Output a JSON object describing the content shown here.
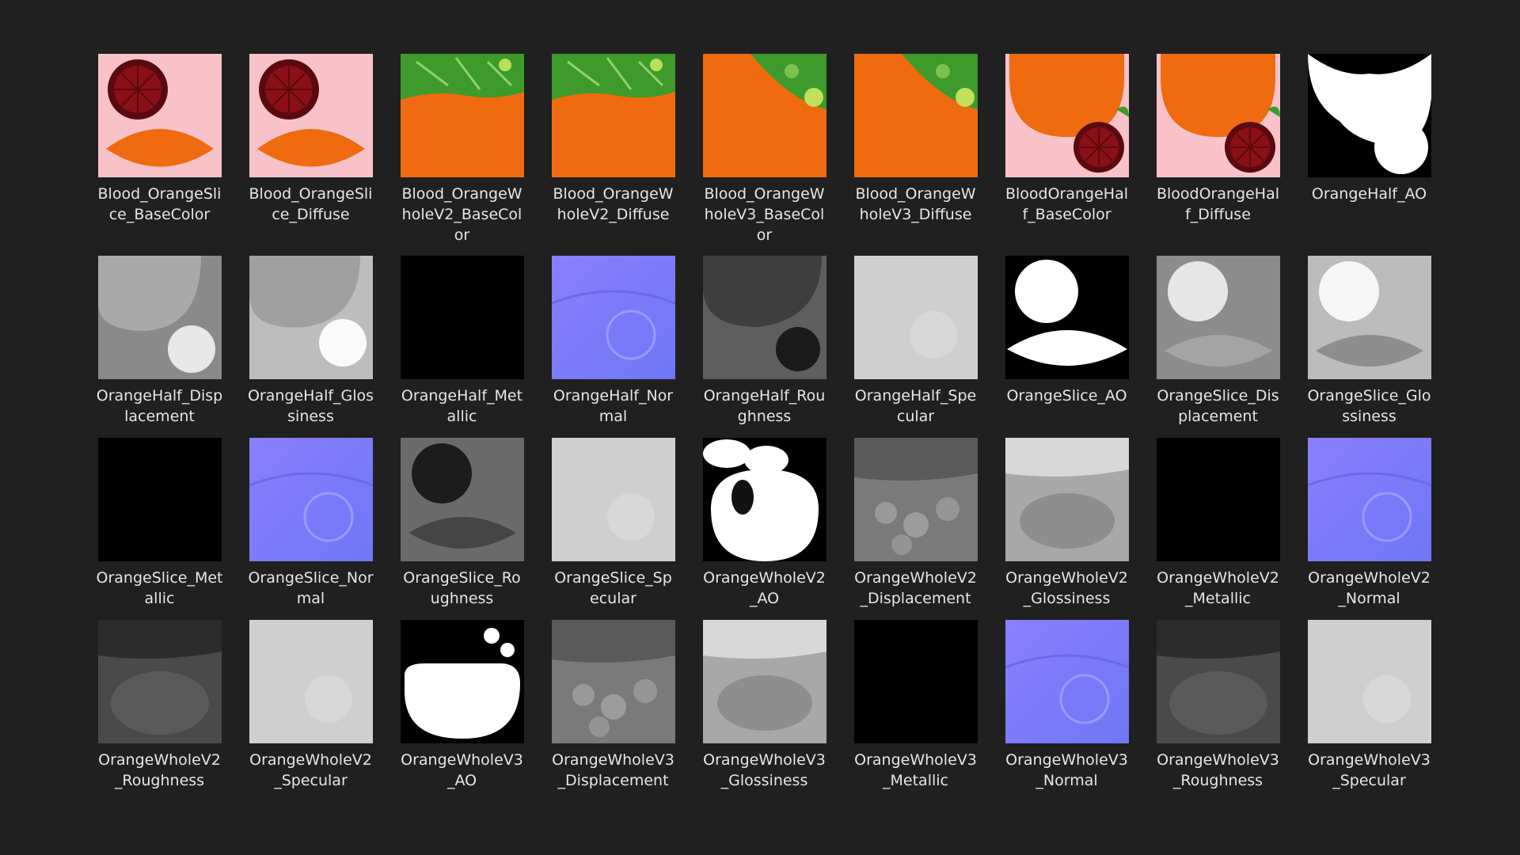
{
  "view": "file-explorer-large-icons",
  "files": [
    {
      "name": "Blood_OrangeSlice_BaseColor",
      "thumb": "slice-color"
    },
    {
      "name": "Blood_OrangeSlice_Diffuse",
      "thumb": "slice-color"
    },
    {
      "name": "Blood_OrangeWholeV2_BaseColor",
      "thumb": "whole-v2-color"
    },
    {
      "name": "Blood_OrangeWholeV2_Diffuse",
      "thumb": "whole-v2-color"
    },
    {
      "name": "Blood_OrangeWholeV3_BaseColor",
      "thumb": "whole-v3-color"
    },
    {
      "name": "Blood_OrangeWholeV3_Diffuse",
      "thumb": "whole-v3-color"
    },
    {
      "name": "BloodOrangeHalf_BaseColor",
      "thumb": "half-color"
    },
    {
      "name": "BloodOrangeHalf_Diffuse",
      "thumb": "half-color"
    },
    {
      "name": "OrangeHalf_AO",
      "thumb": "half-ao"
    },
    {
      "name": "OrangeHalf_Displacement",
      "thumb": "half-disp"
    },
    {
      "name": "OrangeHalf_Glossiness",
      "thumb": "half-gloss"
    },
    {
      "name": "OrangeHalf_Metallic",
      "thumb": "black"
    },
    {
      "name": "OrangeHalf_Normal",
      "thumb": "normal"
    },
    {
      "name": "OrangeHalf_Roughness",
      "thumb": "half-rough"
    },
    {
      "name": "OrangeHalf_Specular",
      "thumb": "light-gray"
    },
    {
      "name": "OrangeSlice_AO",
      "thumb": "slice-ao"
    },
    {
      "name": "OrangeSlice_Displacement",
      "thumb": "slice-disp"
    },
    {
      "name": "OrangeSlice_Glossiness",
      "thumb": "slice-gloss"
    },
    {
      "name": "OrangeSlice_Metallic",
      "thumb": "black"
    },
    {
      "name": "OrangeSlice_Normal",
      "thumb": "normal"
    },
    {
      "name": "OrangeSlice_Roughness",
      "thumb": "slice-rough"
    },
    {
      "name": "OrangeSlice_Specular",
      "thumb": "light-gray"
    },
    {
      "name": "OrangeWholeV2_AO",
      "thumb": "whole-ao"
    },
    {
      "name": "OrangeWholeV2_Displacement",
      "thumb": "whole-disp"
    },
    {
      "name": "OrangeWholeV2_Glossiness",
      "thumb": "whole-gloss"
    },
    {
      "name": "OrangeWholeV2_Metallic",
      "thumb": "black"
    },
    {
      "name": "OrangeWholeV2_Normal",
      "thumb": "normal"
    },
    {
      "name": "OrangeWholeV2_Roughness",
      "thumb": "whole-rough"
    },
    {
      "name": "OrangeWholeV2_Specular",
      "thumb": "light-gray"
    },
    {
      "name": "OrangeWholeV3_AO",
      "thumb": "whole-v3-ao"
    },
    {
      "name": "OrangeWholeV3_Displacement",
      "thumb": "whole-disp"
    },
    {
      "name": "OrangeWholeV3_Glossiness",
      "thumb": "whole-gloss"
    },
    {
      "name": "OrangeWholeV3_Metallic",
      "thumb": "black"
    },
    {
      "name": "OrangeWholeV3_Normal",
      "thumb": "normal"
    },
    {
      "name": "OrangeWholeV3_Roughness",
      "thumb": "whole-rough"
    },
    {
      "name": "OrangeWholeV3_Specular",
      "thumb": "light-gray"
    }
  ],
  "colors": {
    "background": "#202020",
    "label": "#e6e6e6",
    "orange": "#f06a10",
    "pink": "#f8c2c8",
    "blood_red": "#8a0f16",
    "leaf_green": "#3f9a2c",
    "normal_blue": "#7f7fff"
  }
}
